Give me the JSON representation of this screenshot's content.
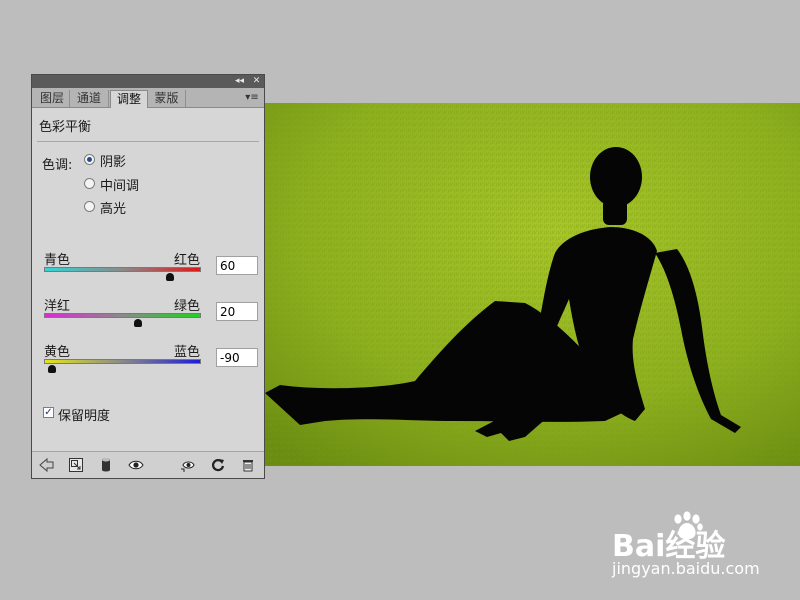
{
  "panel": {
    "tabs": [
      {
        "label": "图层",
        "active": false
      },
      {
        "label": "通道",
        "active": false
      },
      {
        "label": "调整",
        "active": true
      },
      {
        "label": "蒙版",
        "active": false
      }
    ],
    "collapse_glyph": "◂◂",
    "close_glyph": "✕",
    "menu_glyph": "▾≡",
    "title": "色彩平衡",
    "tone": {
      "label": "色调:",
      "options": [
        {
          "label": "阴影",
          "checked": true
        },
        {
          "label": "中间调",
          "checked": false
        },
        {
          "label": "高光",
          "checked": false
        }
      ]
    },
    "sliders": [
      {
        "left_label": "青色",
        "right_label": "红色",
        "value": "60",
        "level": 0.8,
        "gradient": [
          "#34d4d4",
          "#8a8a8a",
          "#e01818"
        ]
      },
      {
        "left_label": "洋红",
        "right_label": "绿色",
        "value": "20",
        "level": 0.6,
        "gradient": [
          "#dc2ad4",
          "#8a8a8a",
          "#1ed21e"
        ]
      },
      {
        "left_label": "黄色",
        "right_label": "蓝色",
        "value": "-90",
        "level": 0.05,
        "gradient": [
          "#e4e41e",
          "#8a8a8a",
          "#1e1ed6"
        ]
      }
    ],
    "preserve_luminosity": {
      "label": "保留明度",
      "checked": true,
      "check_glyph": "✓"
    },
    "bottom_icons": [
      "back-arrow-icon",
      "clip-layer-icon",
      "layer-mask-icon",
      "visibility-eye-icon",
      "view-previous-icon",
      "reset-icon",
      "delete-icon"
    ]
  },
  "photo": {
    "grass_color": "#8fb21e",
    "silhouette_color": "#050505"
  },
  "watermark": {
    "brand": "Bai经验",
    "site": "jingyan.baidu.com"
  }
}
